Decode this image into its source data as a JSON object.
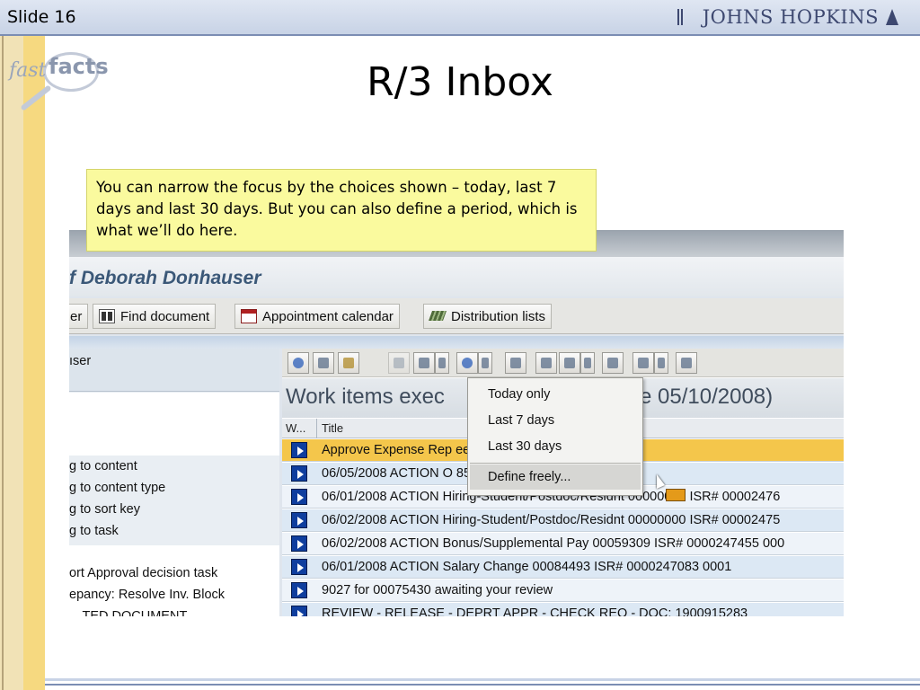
{
  "slide": {
    "number_label": "Slide 16",
    "title": "R/3 Inbox"
  },
  "branding": {
    "institution": "JOHNS HOPKINS",
    "badge_fast": "fast",
    "badge_facts": "facts"
  },
  "callout": {
    "text": "You can narrow the focus by the choices shown – today, last 7 days and last 30 days. But you can also define a period, which is what we’ll do here."
  },
  "sap": {
    "user_title": "f Deborah Donhauser",
    "toolbar": {
      "partial_label": "er",
      "find_document": "Find document",
      "appointment_calendar": "Appointment calendar",
      "distribution_lists": "Distribution lists"
    },
    "left_panel": {
      "header": "ıser",
      "items": [
        "g to content",
        "g to content type",
        "g to sort key",
        "g to task"
      ],
      "lower_items": [
        "ort Approval decision task",
        "epancy: Resolve Inv. Block",
        "…TED DOCUMENT"
      ]
    },
    "work_items": {
      "title": "Work items exec",
      "date_fragment": "e 05/10/2008)",
      "col_w": "W...",
      "col_title": "Title",
      "rows": [
        "Approve Expense Rep                                  ee Wright , Rika",
        "06/05/2008 ACTION O                                  8520 ISR# 0000247634 0001",
        "06/01/2008 ACTION Hiring-Student/Postdoc/Residnt 00000000 ISR# 00002476",
        "06/02/2008 ACTION Hiring-Student/Postdoc/Residnt 00000000 ISR# 00002475",
        "06/02/2008 ACTION Bonus/Supplemental Pay 00059309 ISR# 0000247455 000",
        "06/01/2008 ACTION Salary Change 00084493 ISR# 0000247083 0001",
        "9027 for 00075430 awaiting your review",
        "REVIEW - RELEASE - DEPRT APPR - CHECK REQ - DOC: 1900915283"
      ]
    },
    "dropdown": {
      "today": "Today only",
      "last7": "Last 7 days",
      "last30": "Last 30 days",
      "define": "Define freely..."
    }
  }
}
